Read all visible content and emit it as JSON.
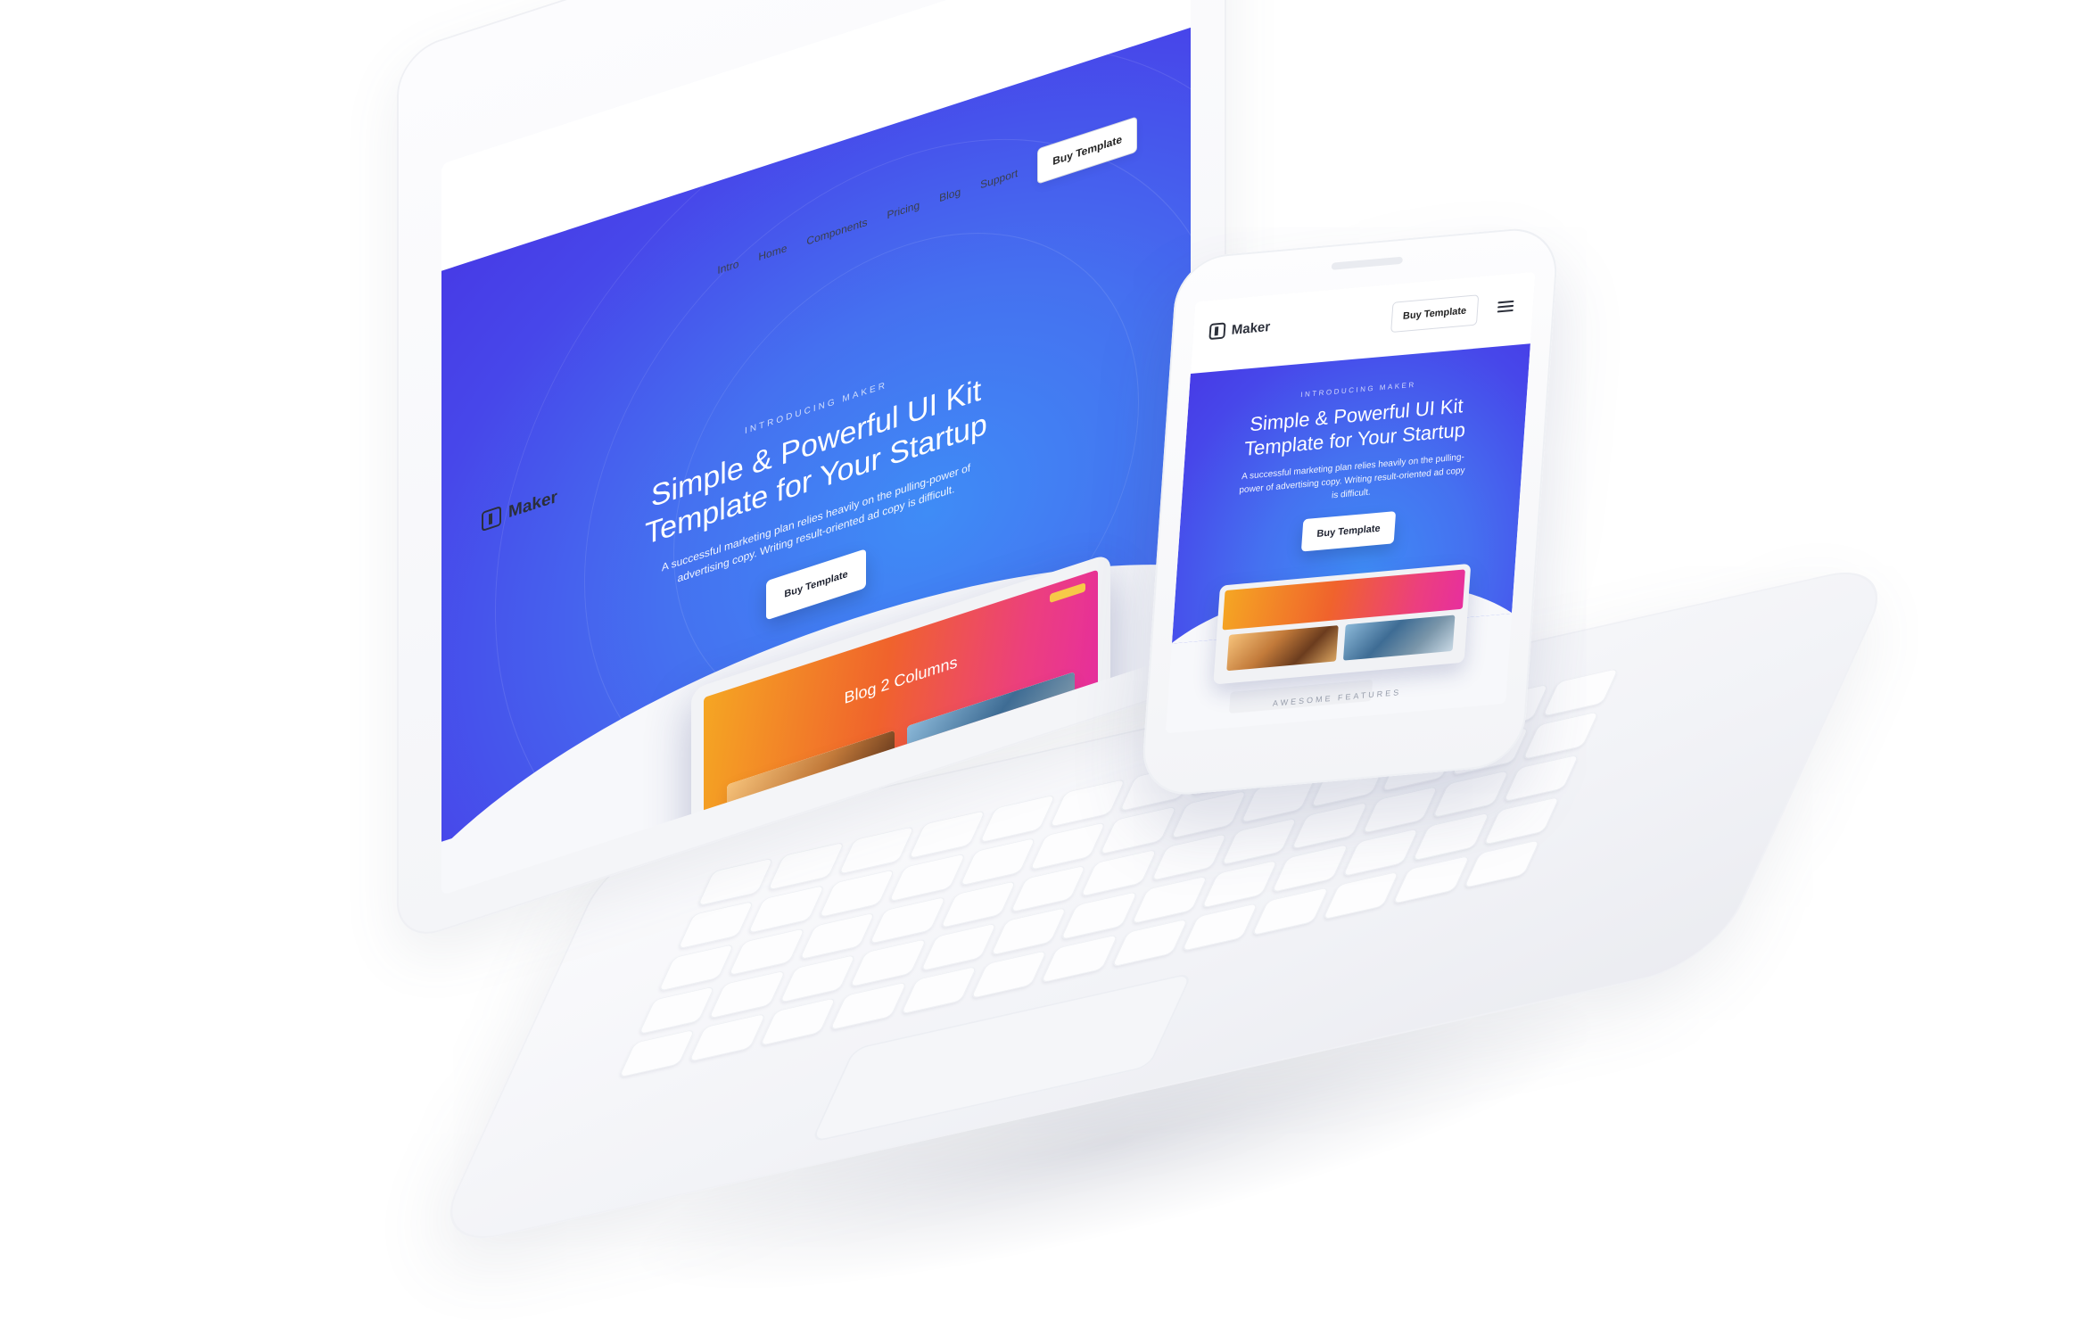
{
  "laptop": {
    "brand": "Maker",
    "nav": [
      "Intro",
      "Home",
      "Components",
      "Pricing",
      "Blog",
      "Support"
    ],
    "nav_cta": "Buy Template",
    "hero": {
      "eyebrow": "Introducing Maker",
      "title": "Simple & Powerful UI Kit Template for Your Startup",
      "subtitle": "A successful marketing plan relies heavily on the pulling-power of advertising copy. Writing result-oriented ad copy is difficult.",
      "button": "Buy Template"
    },
    "preview": {
      "title": "Blog 2 Columns"
    }
  },
  "phone": {
    "brand": "Maker",
    "header_cta": "Buy Template",
    "hero": {
      "eyebrow": "Introducing Maker",
      "title": "Simple & Powerful UI Kit Template for Your Startup",
      "subtitle": "A successful marketing plan relies heavily on the pulling-power of advertising copy. Writing result-oriented ad copy is difficult.",
      "button": "Buy Template"
    },
    "section_label": "Awesome Features"
  },
  "colors": {
    "hero_blue": "#4747ea",
    "hero_light_blue": "#3f8cf6",
    "preview_orange": "#f0632c",
    "preview_pink": "#e72f9d",
    "device_white": "#f7f8fb"
  },
  "icons": [
    "maker-logo-icon",
    "hamburger-menu-icon"
  ]
}
